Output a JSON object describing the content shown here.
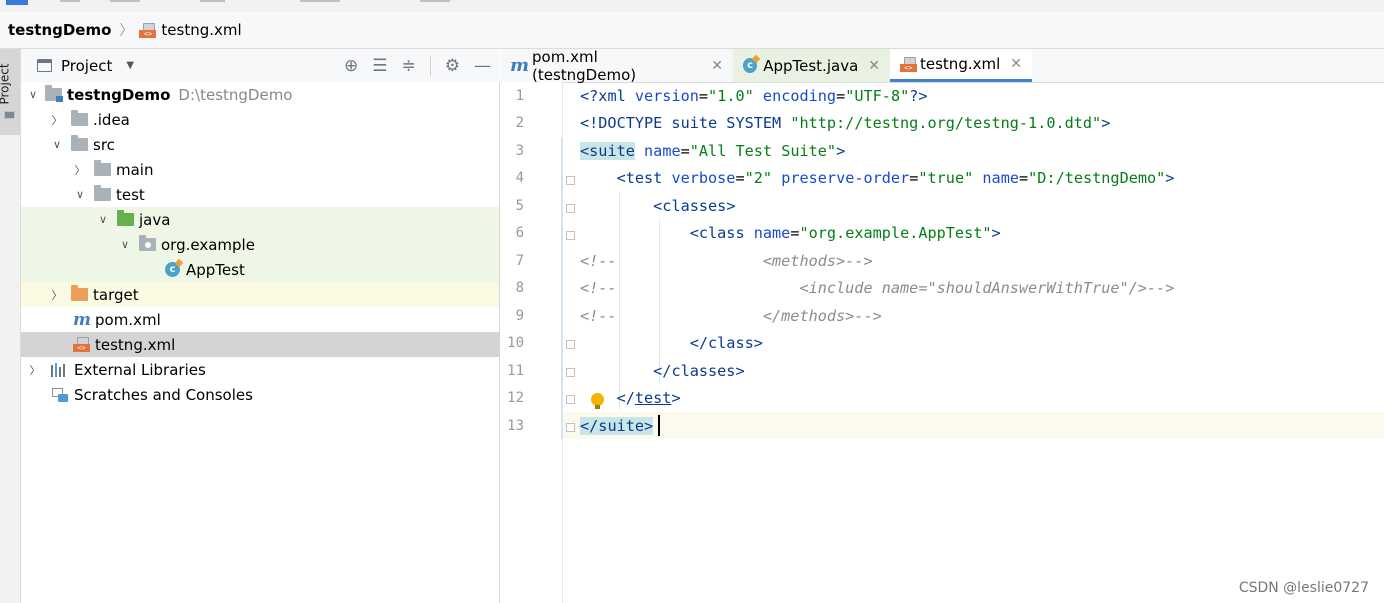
{
  "navbar": {
    "project": "testngDemo",
    "file": "testng.xml"
  },
  "sidestrip": {
    "label": "Project"
  },
  "project_panel": {
    "title": "Project"
  },
  "tree": [
    {
      "label": "testngDemo",
      "path": "D:\\testngDemo"
    },
    {
      "label": ".idea"
    },
    {
      "label": "src"
    },
    {
      "label": "main"
    },
    {
      "label": "test"
    },
    {
      "label": "java"
    },
    {
      "label": "org.example"
    },
    {
      "label": "AppTest"
    },
    {
      "label": "target"
    },
    {
      "label": "pom.xml"
    },
    {
      "label": "testng.xml"
    },
    {
      "label": "External Libraries"
    },
    {
      "label": "Scratches and Consoles"
    }
  ],
  "tabs": [
    {
      "label": "pom.xml (testngDemo)"
    },
    {
      "label": "AppTest.java"
    },
    {
      "label": "testng.xml"
    }
  ],
  "line_numbers": [
    "1",
    "2",
    "3",
    "4",
    "5",
    "6",
    "7",
    "8",
    "9",
    "10",
    "11",
    "12",
    "13"
  ],
  "watermark": "CSDN @leslie0727",
  "code": {
    "l1": {
      "a": "<?",
      "b": "xml ",
      "c": "version",
      "d": "=",
      "e": "\"1.0\"",
      "f": " ",
      "g": "encoding",
      "h": "=",
      "i": "\"UTF-8\"",
      "j": "?>"
    },
    "l2": {
      "a": "<!DOCTYPE suite SYSTEM ",
      "b": "\"http://testng.org/testng-1.0.dtd\"",
      "c": ">"
    },
    "l3": {
      "a": "<",
      "b": "suite",
      "c": " ",
      "d": "name",
      "e": "=",
      "f": "\"All Test Suite\"",
      "g": ">"
    },
    "l4": {
      "a": "    <",
      "b": "test ",
      "c": "verbose",
      "d": "=",
      "e": "\"2\"",
      "f": " ",
      "g": "preserve-order",
      "h": "=",
      "i": "\"true\"",
      "j": " ",
      "k": "name",
      "l": "=",
      "m": "\"D:/testngDemo\"",
      "n": ">"
    },
    "l5": {
      "a": "        <",
      "b": "classes",
      "c": ">"
    },
    "l6": {
      "a": "            <",
      "b": "class ",
      "c": "name",
      "d": "=",
      "e": "\"org.example.AppTest\"",
      "f": ">"
    },
    "l7": {
      "a": "<!--                <methods>-->"
    },
    "l8": {
      "a": "<!--                    <include name=\"shouldAnswerWithTrue\"/>-->"
    },
    "l9": {
      "a": "<!--                </methods>-->"
    },
    "l10": {
      "a": "            </",
      "b": "class",
      "c": ">"
    },
    "l11": {
      "a": "        </",
      "b": "classes",
      "c": ">"
    },
    "l12": {
      "a": "    </",
      "b": "test",
      "c": ">"
    },
    "l13": {
      "a": "</",
      "b": "suite",
      "c": ">"
    }
  }
}
